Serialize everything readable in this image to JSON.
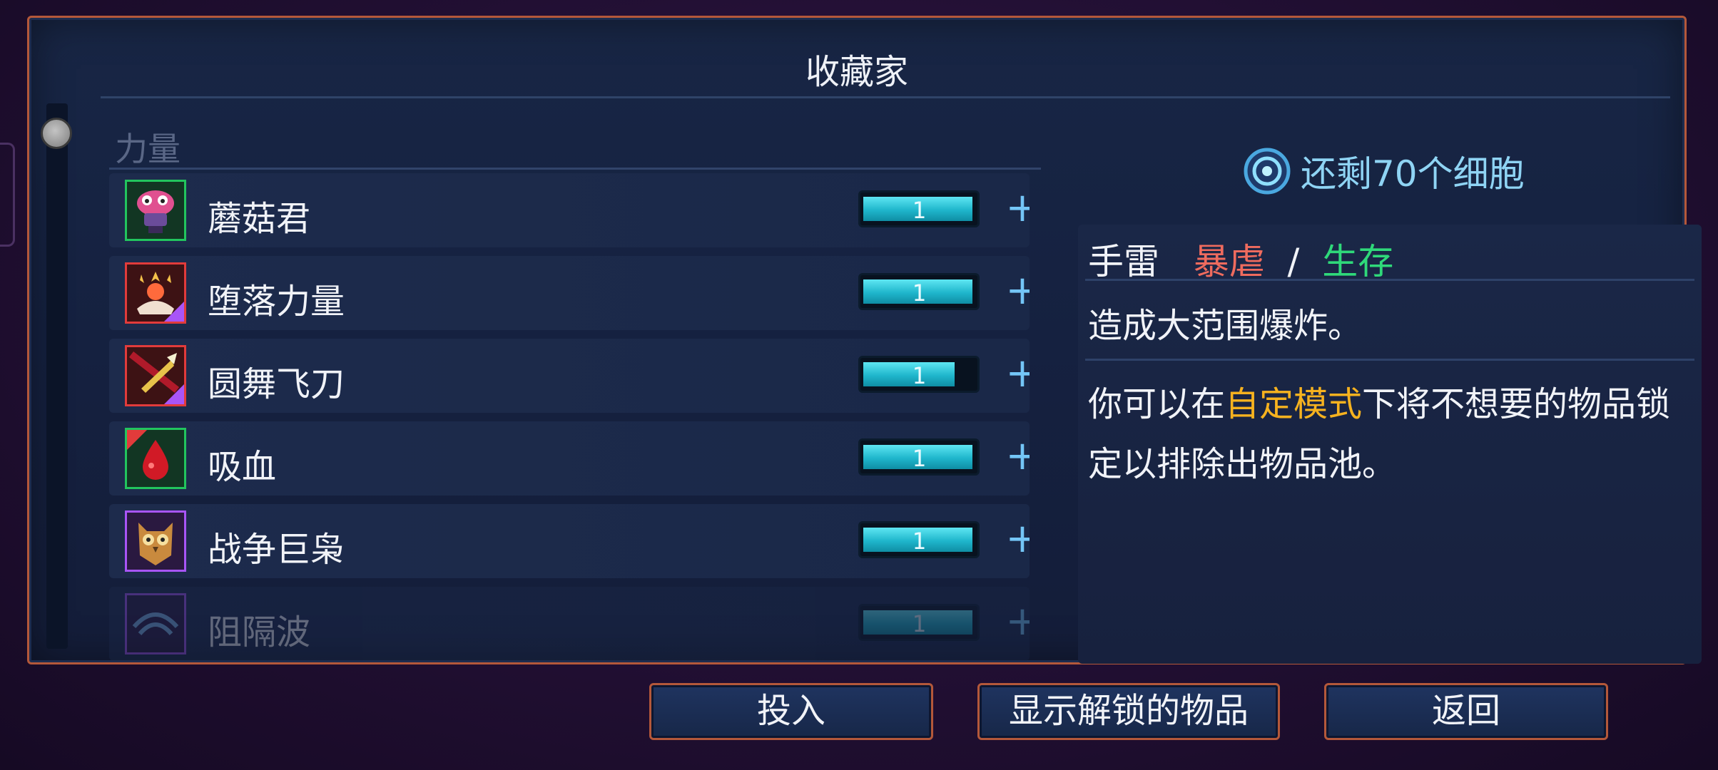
{
  "panel": {
    "title": "收藏家"
  },
  "category": {
    "label": "力量"
  },
  "items": [
    {
      "name": "蘑菇君",
      "value": "1",
      "fill": 0.98
    },
    {
      "name": "堕落力量",
      "value": "1",
      "fill": 0.98
    },
    {
      "name": "圆舞飞刀",
      "value": "1",
      "fill": 0.82
    },
    {
      "name": "吸血",
      "value": "1",
      "fill": 0.98
    },
    {
      "name": "战争巨枭",
      "value": "1",
      "fill": 0.98
    },
    {
      "name": "阻隔波",
      "value": "1",
      "fill": 0.98
    }
  ],
  "plus_symbol": "+",
  "cells": {
    "text": "还剩70个细胞"
  },
  "info": {
    "item_name": "手雷",
    "stat1": "暴虐",
    "separator": "/",
    "stat2": "生存",
    "description": "造成大范围爆炸。",
    "tip_pre": "你可以在",
    "tip_highlight": "自定模式",
    "tip_post": "下将不想要的物品锁定以排除出物品池。"
  },
  "buttons": {
    "invest": "投入",
    "show_unlocked": "显示解锁的物品",
    "back": "返回"
  },
  "colors": {
    "frame": "#b4583a",
    "bar": "#1fb6cc",
    "plus": "#74c6f7",
    "red_stat": "#ef6b5e",
    "green_stat": "#2fd97a",
    "highlight": "#f6b21f"
  }
}
